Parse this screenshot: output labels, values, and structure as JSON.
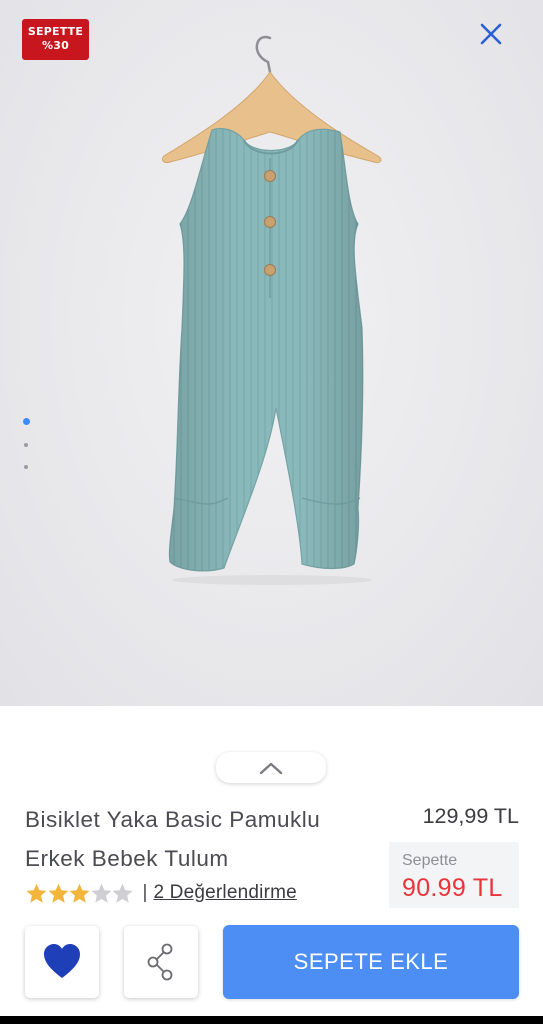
{
  "badge": {
    "line1": "SEPETTE",
    "line2": "%30"
  },
  "carousel": {
    "total": 3,
    "active": 0
  },
  "product": {
    "title_line1": "Bisiklet Yaka Basic Pamuklu",
    "title_line2": "Erkek Bebek Tulum",
    "old_price": "129,99 TL",
    "promo_label": "Sepette",
    "promo_price": "90.99 TL",
    "rating": 3,
    "rating_max": 5,
    "rating_separator": "|",
    "reviews_link": "2 Değerlendirme"
  },
  "actions": {
    "add_to_cart": "SEPETE EKLE"
  },
  "colors": {
    "badge": "#c8161e",
    "close_icon": "#2a5fd6",
    "accent_button": "#4d8ef5",
    "promo_price": "#e8343b",
    "star_filled": "#f2b63c",
    "star_empty": "#cfcfd3",
    "heart": "#1f3fb8",
    "garment": "#8ab9bb"
  },
  "icons": {
    "close": "close-icon",
    "collapse": "chevron-up-icon",
    "favorite": "heart-icon",
    "share": "share-icon"
  }
}
